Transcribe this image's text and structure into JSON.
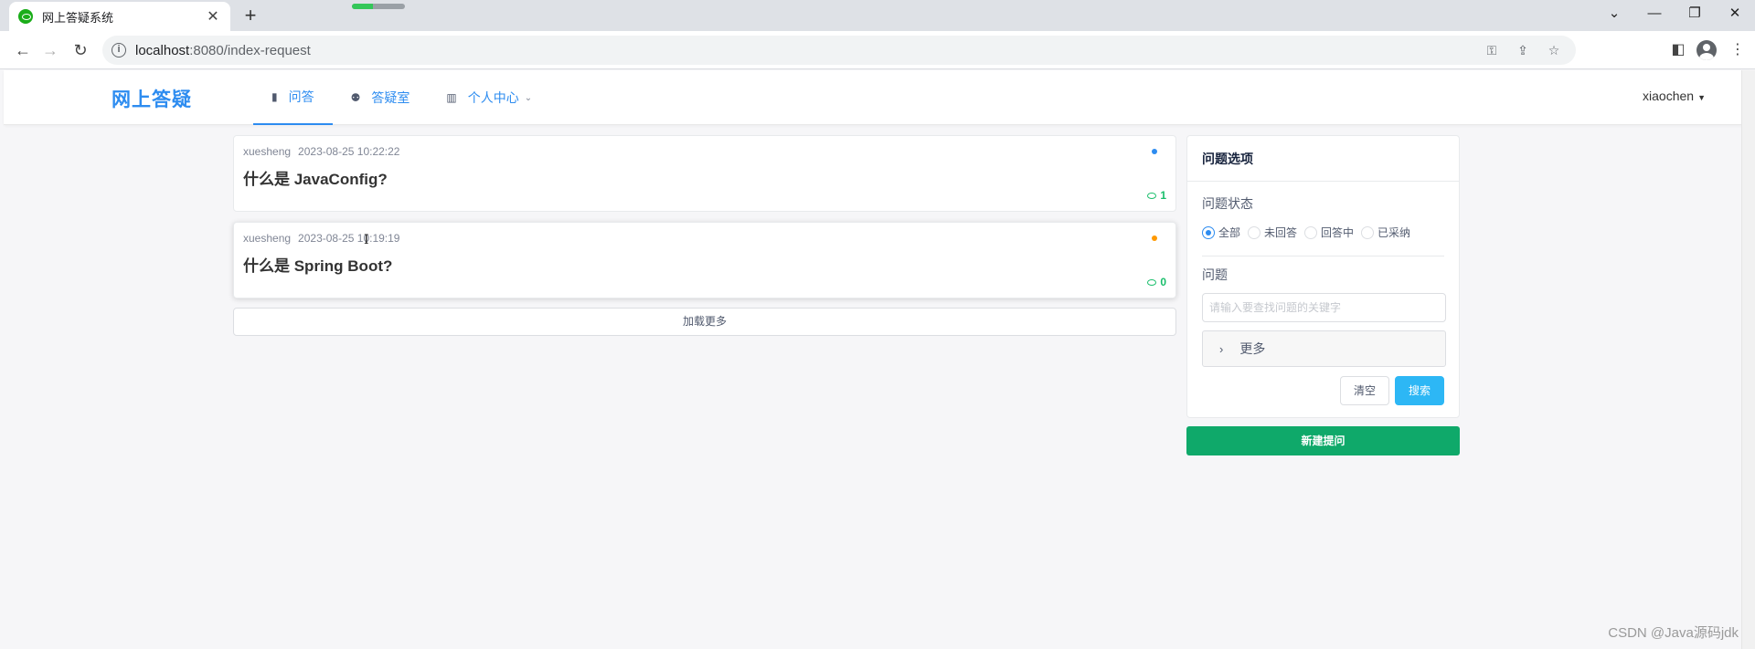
{
  "browser": {
    "tab_title": "网上答疑系统",
    "url_host": "localhost",
    "url_path": ":8080/index-request"
  },
  "header": {
    "brand": "网上答疑",
    "nav": [
      {
        "label": "问答",
        "icon": "book-icon"
      },
      {
        "label": "答疑室",
        "icon": "group-icon"
      },
      {
        "label": "个人中心",
        "icon": "bar-chart-icon"
      }
    ],
    "user": "xiaochen"
  },
  "questions": [
    {
      "author": "xuesheng",
      "date": "2023-08-25 10:22:22",
      "title": "什么是 JavaConfig?",
      "count": "1",
      "status_color": "#2d8cf0"
    },
    {
      "author": "xuesheng",
      "date": "2023-08-25 10:19:19",
      "title": "什么是 Spring Boot?",
      "count": "0",
      "status_color": "#ff9900"
    }
  ],
  "load_more": "加载更多",
  "panel": {
    "title": "问题选项",
    "status_label": "问题状态",
    "status_options": [
      "全部",
      "未回答",
      "回答中",
      "已采纳"
    ],
    "status_selected": "全部",
    "question_label": "问题",
    "search_placeholder": "请输入要查找问题的关键字",
    "more_label": "更多",
    "clear_label": "清空",
    "search_label": "搜索"
  },
  "new_question_label": "新建提问",
  "watermark": "CSDN @Java源码jdk"
}
